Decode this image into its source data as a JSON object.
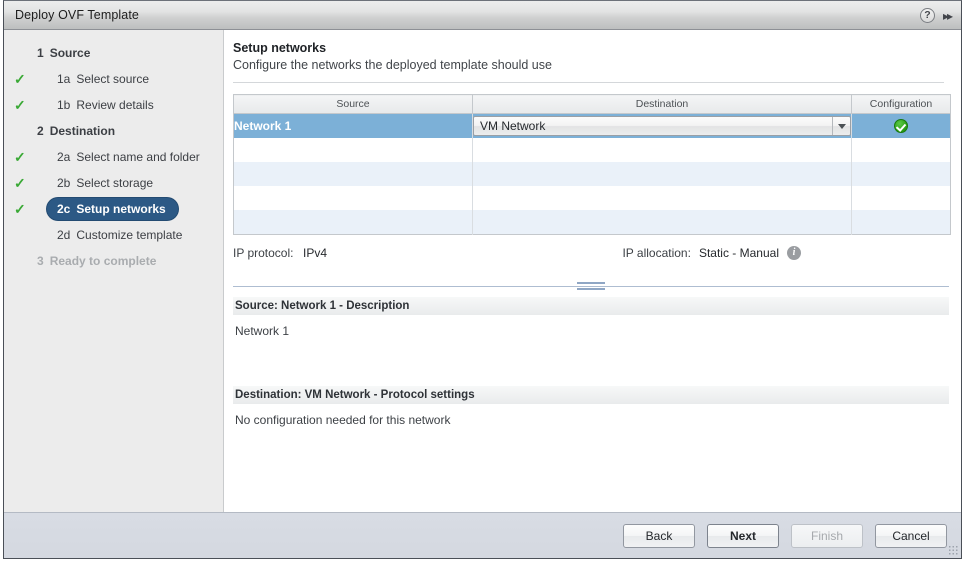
{
  "window": {
    "title": "Deploy OVF Template",
    "help_icon": "question-mark-icon",
    "collapse_icon": "double-chevron-right-icon"
  },
  "sidebar": {
    "items": [
      {
        "num": "1",
        "label": "Source",
        "checked": false,
        "level": 1,
        "selected": false,
        "disabled": false
      },
      {
        "num": "1a",
        "label": "Select source",
        "checked": true,
        "level": 2,
        "selected": false,
        "disabled": false
      },
      {
        "num": "1b",
        "label": "Review details",
        "checked": true,
        "level": 2,
        "selected": false,
        "disabled": false
      },
      {
        "num": "2",
        "label": "Destination",
        "checked": false,
        "level": 1,
        "selected": false,
        "disabled": false
      },
      {
        "num": "2a",
        "label": "Select name and folder",
        "checked": true,
        "level": 2,
        "selected": false,
        "disabled": false
      },
      {
        "num": "2b",
        "label": "Select storage",
        "checked": true,
        "level": 2,
        "selected": false,
        "disabled": false
      },
      {
        "num": "2c",
        "label": "Setup networks",
        "checked": true,
        "level": 2,
        "selected": true,
        "disabled": false
      },
      {
        "num": "2d",
        "label": "Customize template",
        "checked": false,
        "level": 2,
        "selected": false,
        "disabled": false
      },
      {
        "num": "3",
        "label": "Ready to complete",
        "checked": false,
        "level": 1,
        "selected": false,
        "disabled": true
      }
    ]
  },
  "content": {
    "title": "Setup networks",
    "subtitle": "Configure the networks the deployed template should use",
    "table": {
      "columns": [
        "Source",
        "Destination",
        "Configuration"
      ],
      "rows": [
        {
          "source": "Network 1",
          "destination": "VM Network",
          "configuration_icon": "green-check-icon",
          "selected": true
        },
        {
          "source": "",
          "destination": "",
          "configuration_icon": "",
          "selected": false
        },
        {
          "source": "",
          "destination": "",
          "configuration_icon": "",
          "selected": false
        },
        {
          "source": "",
          "destination": "",
          "configuration_icon": "",
          "selected": false
        },
        {
          "source": "",
          "destination": "",
          "configuration_icon": "",
          "selected": false
        }
      ]
    },
    "ip_protocol_label": "IP protocol:",
    "ip_protocol_value": "IPv4",
    "ip_allocation_label": "IP allocation:",
    "ip_allocation_value": "Static - Manual",
    "ip_allocation_info_icon": "info-icon",
    "source_section": {
      "heading": "Source: Network 1 - Description",
      "body": "Network 1"
    },
    "destination_section": {
      "heading": "Destination: VM Network - Protocol settings",
      "body": "No configuration needed for this network"
    }
  },
  "footer": {
    "back": "Back",
    "next": "Next",
    "finish": "Finish",
    "cancel": "Cancel"
  },
  "colors": {
    "accent_selected_row": "#7cb0d7",
    "nav_selected": "#2c5985",
    "check_green": "#3aa935",
    "footer_bg": "#d6dae2"
  }
}
